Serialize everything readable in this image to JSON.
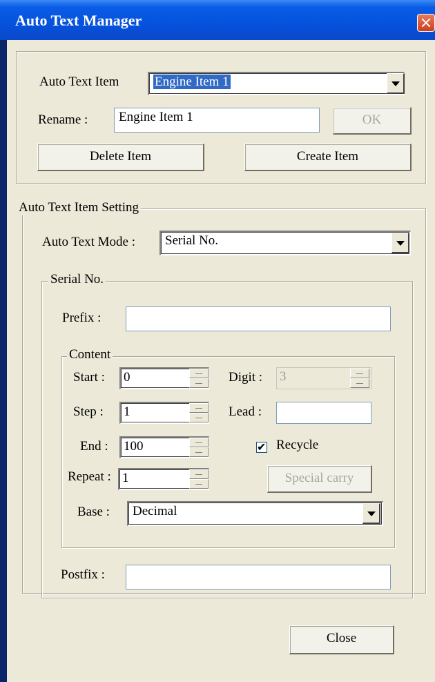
{
  "window": {
    "title": "Auto Text Manager"
  },
  "item_group": {
    "item_label": "Auto Text Item",
    "item_value": "Engine Item 1",
    "rename_label": "Rename :",
    "rename_value": "Engine Item 1",
    "ok_label": "OK",
    "delete_label": "Delete Item",
    "create_label": "Create Item"
  },
  "setting_group": {
    "legend": "Auto Text Item Setting",
    "mode_label": "Auto Text Mode :",
    "mode_value": "Serial No."
  },
  "serial_group": {
    "legend": "Serial No.",
    "prefix_label": "Prefix :",
    "prefix_value": "",
    "postfix_label": "Postfix :",
    "postfix_value": ""
  },
  "content_group": {
    "legend": "Content",
    "start_label": "Start :",
    "start_value": "0",
    "step_label": "Step :",
    "step_value": "1",
    "end_label": "End :",
    "end_value": "100",
    "repeat_label": "Repeat :",
    "repeat_value": "1",
    "digit_label": "Digit :",
    "digit_value": "3",
    "lead_label": "Lead :",
    "lead_value": "",
    "recycle_label": "Recycle",
    "recycle_checked": true,
    "special_carry_label": "Special carry",
    "base_label": "Base :",
    "base_value": "Decimal"
  },
  "footer": {
    "close_label": "Close"
  },
  "icons": {
    "close": "close-icon",
    "dropdown": "chevron-down-icon",
    "spin": "spinner-icon",
    "check": "checkmark-icon"
  }
}
